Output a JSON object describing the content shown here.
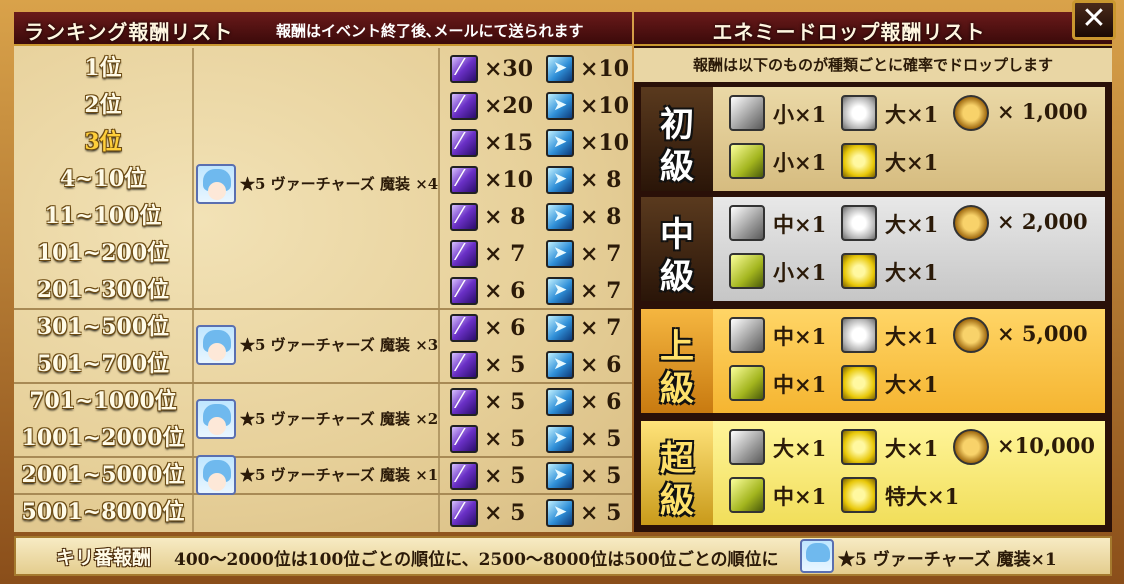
{
  "ranking": {
    "title": "ランキング報酬リスト",
    "note": "報酬はイベント終了後､メールにて送られます",
    "ranks": [
      "1位",
      "2位",
      "3位",
      "4~10位",
      "11~100位",
      "101~200位",
      "201~300位",
      "301~500位",
      "501~700位",
      "701~1000位",
      "1001~2000位",
      "2001~5000位",
      "5001~8000位"
    ],
    "character_groups": [
      {
        "label": "★5 ヴァーチャーズ 魔装 ×4"
      },
      {
        "label": "★5 ヴァーチャーズ 魔装 ×3"
      },
      {
        "label": "★5 ヴァーチャーズ 魔装 ×2"
      },
      {
        "label": "★5 ヴァーチャーズ 魔装 ×1"
      }
    ],
    "rewards": [
      {
        "violet": "×30",
        "blue": "×10"
      },
      {
        "violet": "×20",
        "blue": "×10"
      },
      {
        "violet": "×15",
        "blue": "×10"
      },
      {
        "violet": "×10",
        "blue": "× 8"
      },
      {
        "violet": "× 8",
        "blue": "× 8"
      },
      {
        "violet": "× 7",
        "blue": "× 7"
      },
      {
        "violet": "× 6",
        "blue": "× 7"
      },
      {
        "violet": "× 6",
        "blue": "× 7"
      },
      {
        "violet": "× 5",
        "blue": "× 6"
      },
      {
        "violet": "× 5",
        "blue": "× 6"
      },
      {
        "violet": "× 5",
        "blue": "× 5"
      },
      {
        "violet": "× 5",
        "blue": "× 5"
      },
      {
        "violet": "× 5",
        "blue": "× 5"
      }
    ]
  },
  "drops": {
    "title": "エネミードロップ報酬リスト",
    "note": "報酬は以下のものが種類ごとに確率でドロップします",
    "tiers": [
      {
        "c1": "初",
        "c2": "級",
        "r1": [
          "小×1",
          "大×1",
          "× 1,000"
        ],
        "r2": [
          "小×1",
          "大×1"
        ]
      },
      {
        "c1": "中",
        "c2": "級",
        "r1": [
          "中×1",
          "大×1",
          "× 2,000"
        ],
        "r2": [
          "小×1",
          "大×1"
        ]
      },
      {
        "c1": "上",
        "c2": "級",
        "r1": [
          "中×1",
          "大×1",
          "× 5,000"
        ],
        "r2": [
          "中×1",
          "大×1"
        ]
      },
      {
        "c1": "超",
        "c2": "級",
        "r1": [
          "大×1",
          "大×1",
          "×10,000"
        ],
        "r2": [
          "中×1",
          "特大×1"
        ]
      }
    ]
  },
  "bottom": {
    "label": "キリ番報酬",
    "text": "400〜2000位は100位ごとの順位に、2500〜8000位は500位ごとの順位に",
    "reward": "★5 ヴァーチャーズ 魔装×1"
  },
  "close_label": "✕",
  "colors": {
    "header": "#4a1010",
    "panel": "#e9d6a4",
    "gold_rank": "#ffcf3a"
  }
}
